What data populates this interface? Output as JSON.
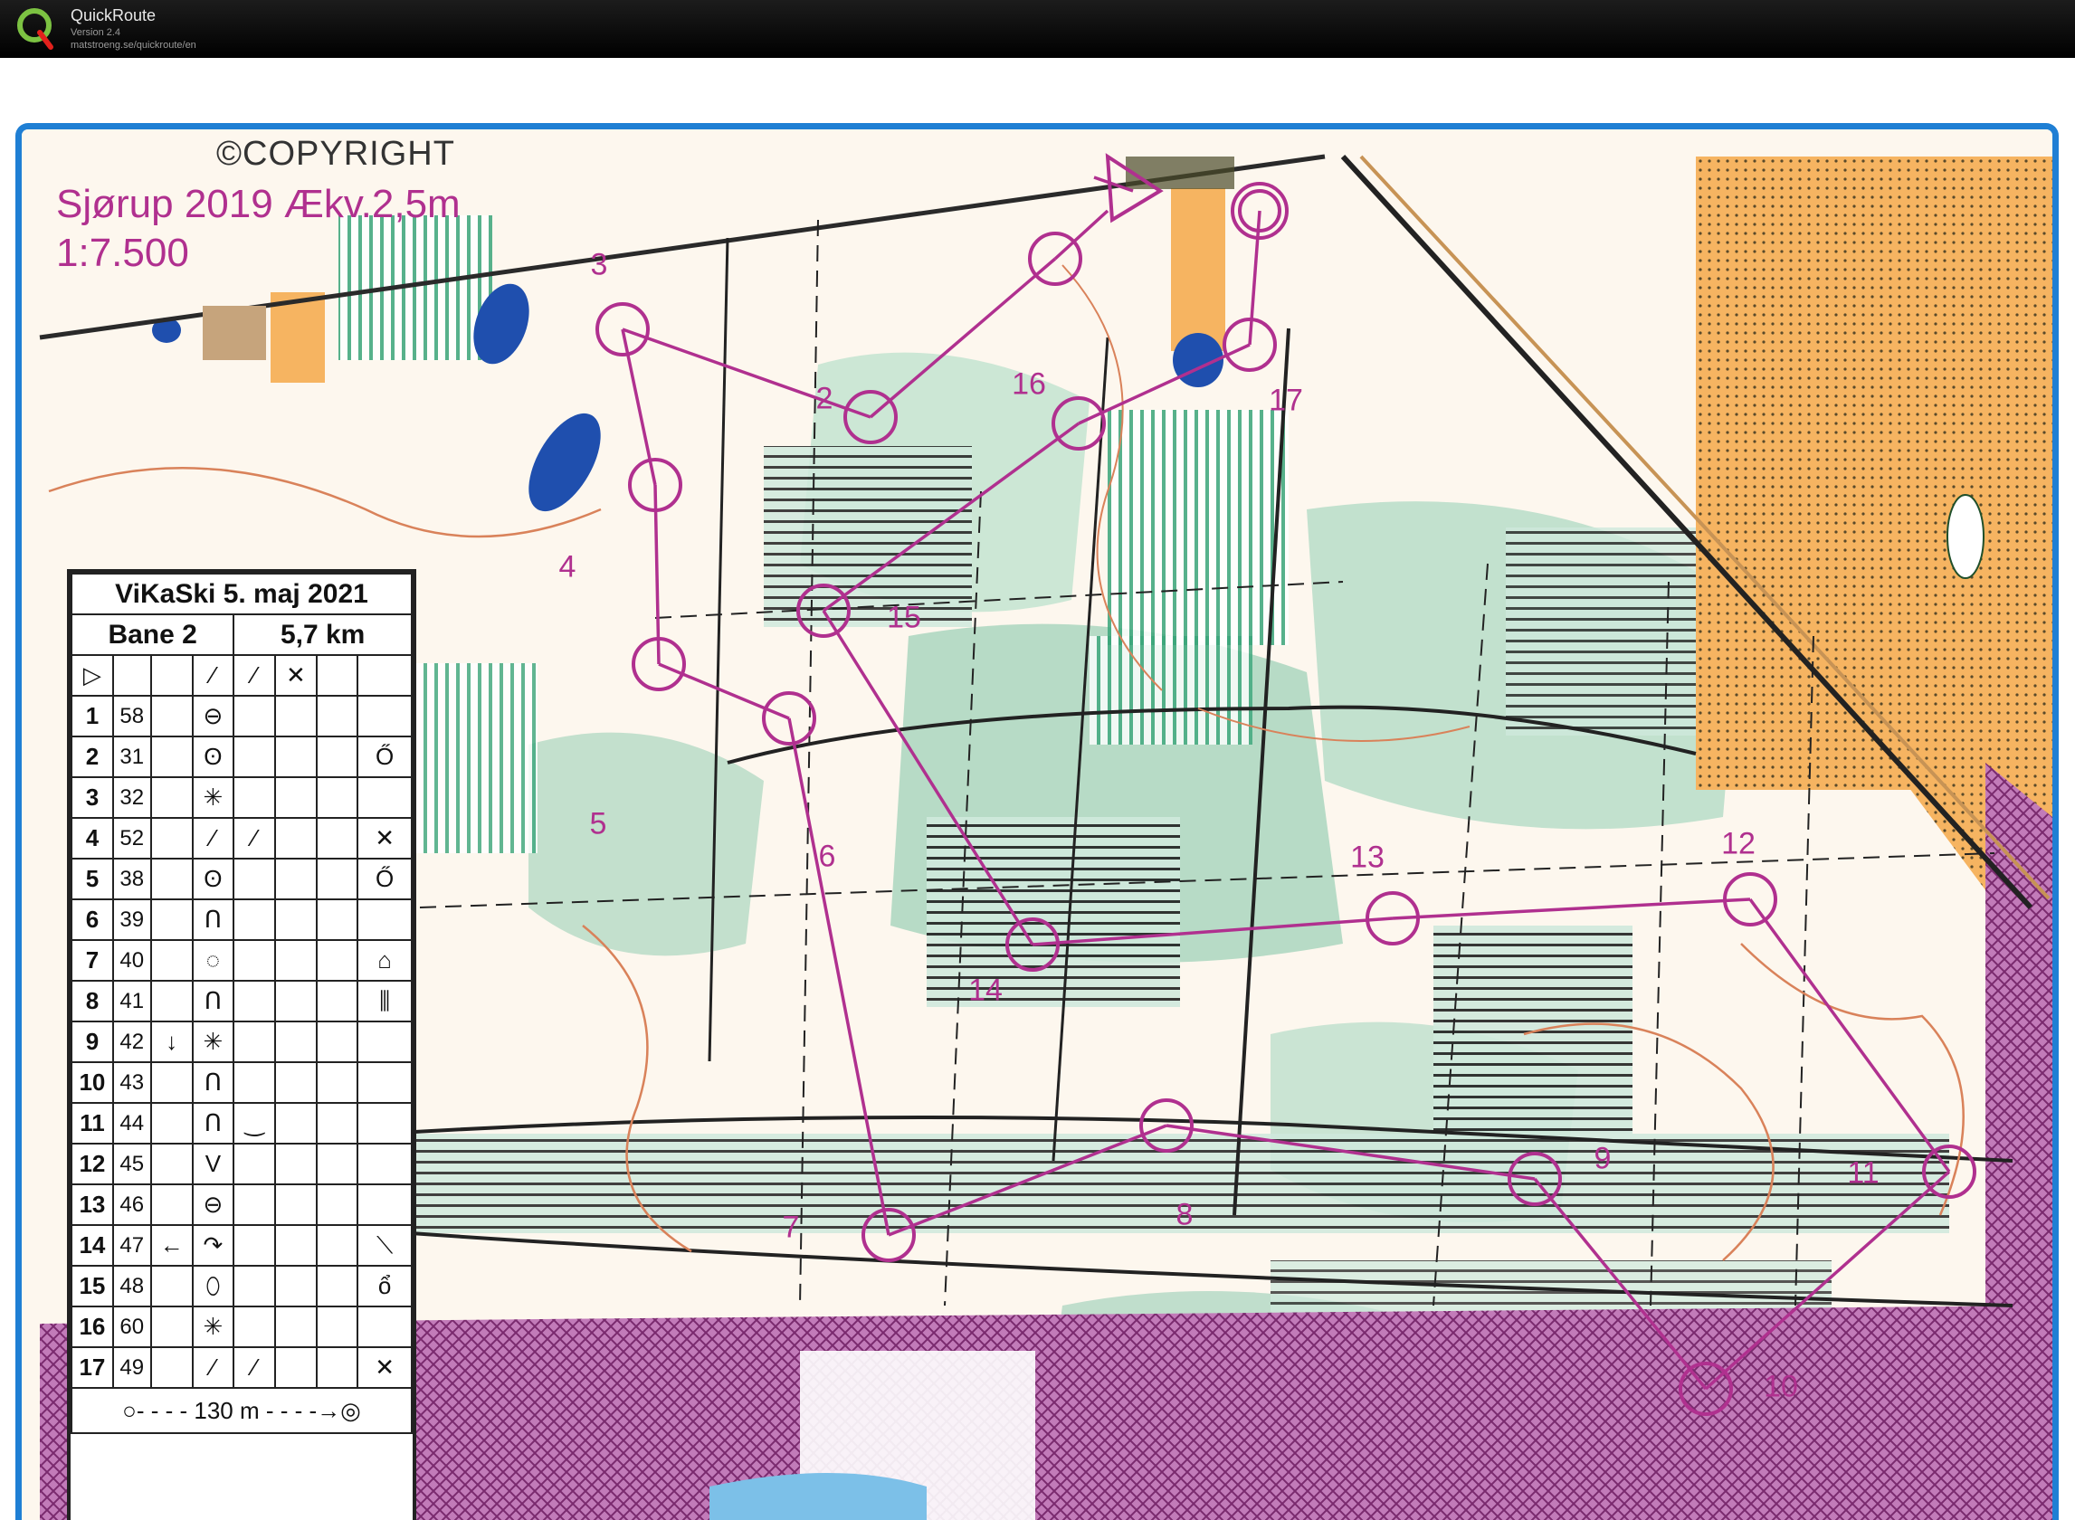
{
  "app": {
    "title": "QuickRoute",
    "version": "Version 2.4",
    "url": "matstroeng.se/quickroute/en"
  },
  "map": {
    "copyright": "©COPYRIGHT",
    "title": "Sjørup 2019 Ækv.2,5m",
    "scale": "1:7.500",
    "course_color": "#b0308f",
    "frame_color": "#1f7fd4",
    "controls": [
      {
        "label": "3"
      },
      {
        "label": "2"
      },
      {
        "label": "16"
      },
      {
        "label": "17"
      },
      {
        "label": "4"
      },
      {
        "label": "15"
      },
      {
        "label": "5"
      },
      {
        "label": "6"
      },
      {
        "label": "14"
      },
      {
        "label": "13"
      },
      {
        "label": "12"
      },
      {
        "label": "8"
      },
      {
        "label": "9"
      },
      {
        "label": "11"
      },
      {
        "label": "7"
      },
      {
        "label": "10"
      }
    ]
  },
  "description_sheet": {
    "event": "ViKaSki 5. maj 2021",
    "course": "Bane 2",
    "length": "5,7 km",
    "rows": [
      {
        "num": "1",
        "code": "58",
        "c": "",
        "d": "⊖",
        "e": "",
        "f": ""
      },
      {
        "num": "2",
        "code": "31",
        "c": "",
        "d": "ʘ",
        "e": "",
        "f": "Ő"
      },
      {
        "num": "3",
        "code": "32",
        "c": "",
        "d": "✳",
        "e": "",
        "f": ""
      },
      {
        "num": "4",
        "code": "52",
        "c": "",
        "d": "⁄",
        "e": "⁄",
        "f": "✕"
      },
      {
        "num": "5",
        "code": "38",
        "c": "",
        "d": "ʘ",
        "e": "",
        "f": "Ő"
      },
      {
        "num": "6",
        "code": "39",
        "c": "",
        "d": "Ո",
        "e": "",
        "f": ""
      },
      {
        "num": "7",
        "code": "40",
        "c": "",
        "d": "◌",
        "e": "",
        "f": "⌂"
      },
      {
        "num": "8",
        "code": "41",
        "c": "",
        "d": "Ո",
        "e": "",
        "f": "⫼"
      },
      {
        "num": "9",
        "code": "42",
        "c": "↓",
        "d": "✳",
        "e": "",
        "f": ""
      },
      {
        "num": "10",
        "code": "43",
        "c": "",
        "d": "Ո",
        "e": "",
        "f": ""
      },
      {
        "num": "11",
        "code": "44",
        "c": "",
        "d": "Ո",
        "e": "‿",
        "f": ""
      },
      {
        "num": "12",
        "code": "45",
        "c": "",
        "d": "V",
        "e": "",
        "f": ""
      },
      {
        "num": "13",
        "code": "46",
        "c": "",
        "d": "⊖",
        "e": "",
        "f": ""
      },
      {
        "num": "14",
        "code": "47",
        "c": "←",
        "d": "↷",
        "e": "",
        "f": "⟍"
      },
      {
        "num": "15",
        "code": "48",
        "c": "",
        "d": "⬯",
        "e": "",
        "f": "ổ"
      },
      {
        "num": "16",
        "code": "60",
        "c": "",
        "d": "✳",
        "e": "",
        "f": ""
      },
      {
        "num": "17",
        "code": "49",
        "c": "",
        "d": "⁄",
        "e": "⁄",
        "f": "✕"
      }
    ],
    "finish": "130 m"
  }
}
